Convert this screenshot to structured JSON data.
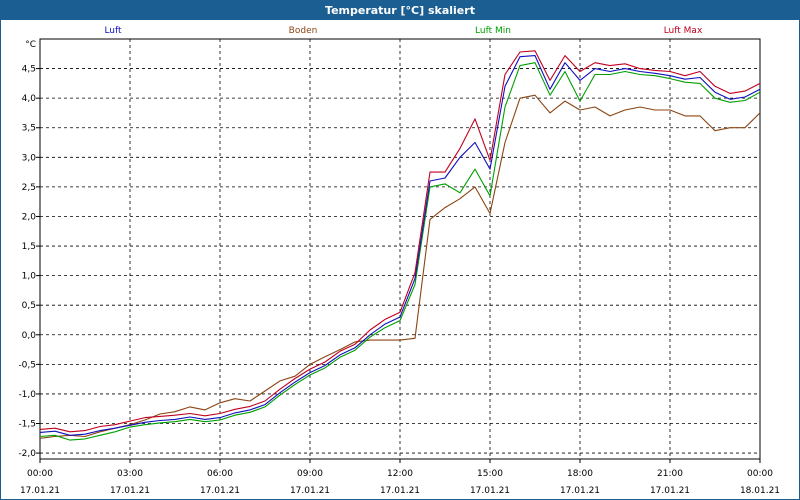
{
  "window": {
    "title": "Temperatur [°C] skaliert"
  },
  "colors": {
    "titlebar": "#1a5e92",
    "Luft": "#1010c0",
    "Boden": "#8b4513",
    "Luft Min": "#00a000",
    "Luft Max": "#c00020"
  },
  "chart_data": {
    "type": "line",
    "title": "Temperatur [°C] skaliert",
    "ylabel": "°C",
    "xlabel": "",
    "ylim": [
      -2.1,
      5.0
    ],
    "yticks": [
      "4,5",
      "4,0",
      "3,5",
      "3,0",
      "2,5",
      "2,0",
      "1,5",
      "1,0",
      "0,5",
      "0,0",
      "-0,5",
      "-1,0",
      "-1,5",
      "-2,0"
    ],
    "ytick_values": [
      4.5,
      4.0,
      3.5,
      3.0,
      2.5,
      2.0,
      1.5,
      1.0,
      0.5,
      0.0,
      -0.5,
      -1.0,
      -1.5,
      -2.0
    ],
    "xticks": [
      {
        "time": "00:00",
        "date": "17.01.21"
      },
      {
        "time": "03:00",
        "date": "17.01.21"
      },
      {
        "time": "06:00",
        "date": "17.01.21"
      },
      {
        "time": "09:00",
        "date": "17.01.21"
      },
      {
        "time": "12:00",
        "date": "17.01.21"
      },
      {
        "time": "15:00",
        "date": "17.01.21"
      },
      {
        "time": "18:00",
        "date": "17.01.21"
      },
      {
        "time": "21:00",
        "date": "17.01.21"
      },
      {
        "time": "00:00",
        "date": "18.01.21"
      }
    ],
    "x_hours": [
      0,
      0.5,
      1,
      1.5,
      2,
      2.5,
      3,
      3.5,
      4,
      4.5,
      5,
      5.5,
      6,
      6.5,
      7,
      7.5,
      8,
      8.5,
      9,
      9.5,
      10,
      10.5,
      11,
      11.5,
      12,
      12.5,
      13,
      13.5,
      14,
      14.5,
      15,
      15.5,
      16,
      16.5,
      17,
      17.5,
      18,
      18.5,
      19,
      19.5,
      20,
      20.5,
      21,
      21.5,
      22,
      22.5,
      23,
      23.5,
      24
    ],
    "grid": true,
    "legend": "top",
    "series": [
      {
        "name": "Luft",
        "values": [
          -1.65,
          -1.63,
          -1.7,
          -1.68,
          -1.62,
          -1.58,
          -1.53,
          -1.48,
          -1.45,
          -1.43,
          -1.39,
          -1.43,
          -1.4,
          -1.32,
          -1.27,
          -1.18,
          -0.98,
          -0.8,
          -0.64,
          -0.52,
          -0.34,
          -0.22,
          0.0,
          0.18,
          0.3,
          0.95,
          2.6,
          2.65,
          3.0,
          3.25,
          2.8,
          4.2,
          4.7,
          4.72,
          4.15,
          4.6,
          4.3,
          4.5,
          4.45,
          4.5,
          4.45,
          4.42,
          4.38,
          4.32,
          4.35,
          4.1,
          3.98,
          4.02,
          4.15
        ]
      },
      {
        "name": "Boden",
        "values": [
          -1.75,
          -1.72,
          -1.7,
          -1.72,
          -1.64,
          -1.58,
          -1.52,
          -1.44,
          -1.34,
          -1.3,
          -1.22,
          -1.27,
          -1.15,
          -1.08,
          -1.12,
          -0.95,
          -0.78,
          -0.7,
          -0.5,
          -0.37,
          -0.25,
          -0.12,
          -0.09,
          -0.09,
          -0.09,
          -0.06,
          1.95,
          2.15,
          2.3,
          2.5,
          2.05,
          3.25,
          4.0,
          4.05,
          3.75,
          3.95,
          3.8,
          3.85,
          3.7,
          3.8,
          3.85,
          3.8,
          3.8,
          3.7,
          3.7,
          3.45,
          3.5,
          3.5,
          3.75
        ]
      },
      {
        "name": "Luft Min",
        "values": [
          -1.72,
          -1.7,
          -1.78,
          -1.76,
          -1.7,
          -1.64,
          -1.56,
          -1.52,
          -1.49,
          -1.47,
          -1.43,
          -1.47,
          -1.44,
          -1.36,
          -1.31,
          -1.22,
          -1.02,
          -0.84,
          -0.68,
          -0.56,
          -0.38,
          -0.26,
          -0.04,
          0.12,
          0.24,
          0.85,
          2.5,
          2.55,
          2.4,
          2.8,
          2.35,
          3.85,
          4.55,
          4.6,
          4.05,
          4.45,
          3.95,
          4.4,
          4.4,
          4.45,
          4.4,
          4.38,
          4.33,
          4.27,
          4.25,
          4.0,
          3.93,
          3.96,
          4.1
        ]
      },
      {
        "name": "Luft Max",
        "values": [
          -1.6,
          -1.58,
          -1.64,
          -1.62,
          -1.55,
          -1.52,
          -1.46,
          -1.4,
          -1.38,
          -1.36,
          -1.33,
          -1.37,
          -1.33,
          -1.26,
          -1.21,
          -1.12,
          -0.92,
          -0.74,
          -0.58,
          -0.46,
          -0.28,
          -0.16,
          0.08,
          0.26,
          0.38,
          1.05,
          2.75,
          2.75,
          3.15,
          3.65,
          2.95,
          4.4,
          4.78,
          4.8,
          4.3,
          4.72,
          4.45,
          4.6,
          4.55,
          4.58,
          4.5,
          4.47,
          4.45,
          4.38,
          4.45,
          4.2,
          4.08,
          4.12,
          4.25
        ]
      }
    ]
  }
}
